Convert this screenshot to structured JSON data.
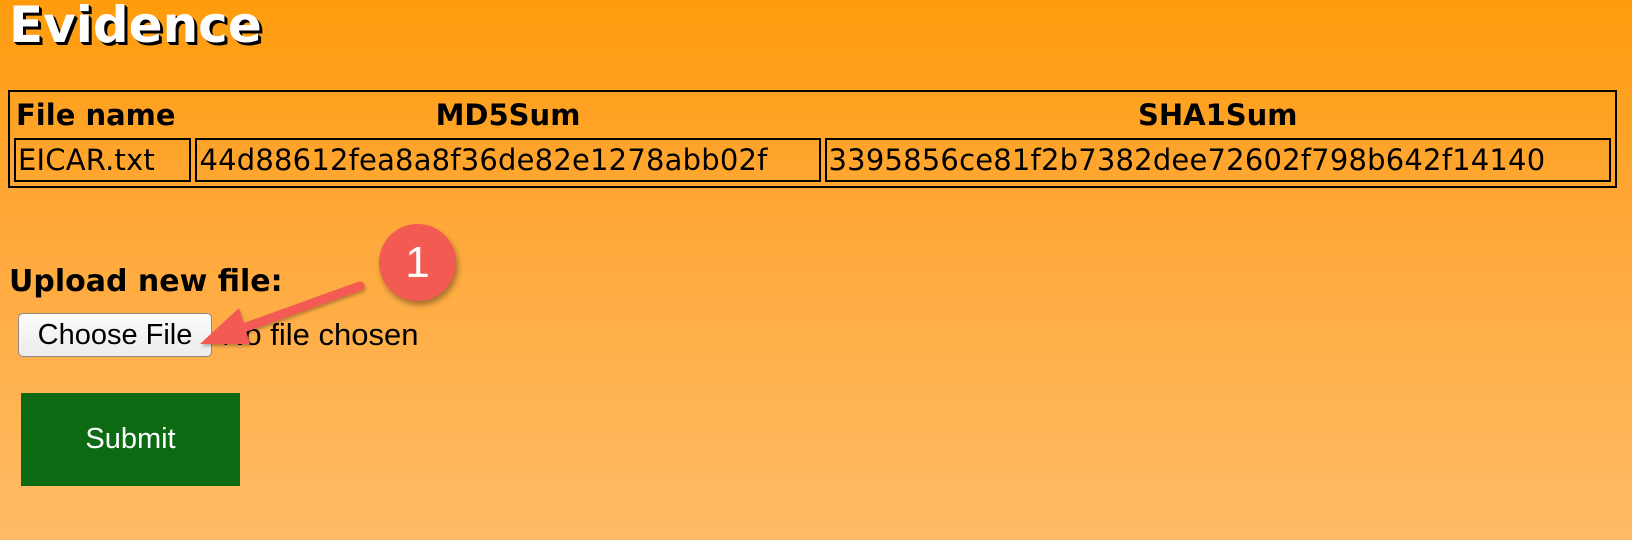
{
  "page": {
    "title": "Evidence"
  },
  "table": {
    "headers": [
      "File name",
      "MD5Sum",
      "SHA1Sum"
    ],
    "rows": [
      {
        "file_name": "EICAR.txt",
        "md5": "44d88612fea8a8f36de82e1278abb02f",
        "sha1": "3395856ce81f2b7382dee72602f798b642f14140"
      }
    ]
  },
  "upload": {
    "label": "Upload new file:",
    "choose_button": "Choose File",
    "status": "No file chosen",
    "submit_label": "Submit"
  },
  "annotation": {
    "badge": "1",
    "badge_color": "#f25a52"
  },
  "colors": {
    "background_top": "#ff9c0c",
    "background_bottom": "#ffbb66",
    "submit_bg": "#0b6a12"
  }
}
